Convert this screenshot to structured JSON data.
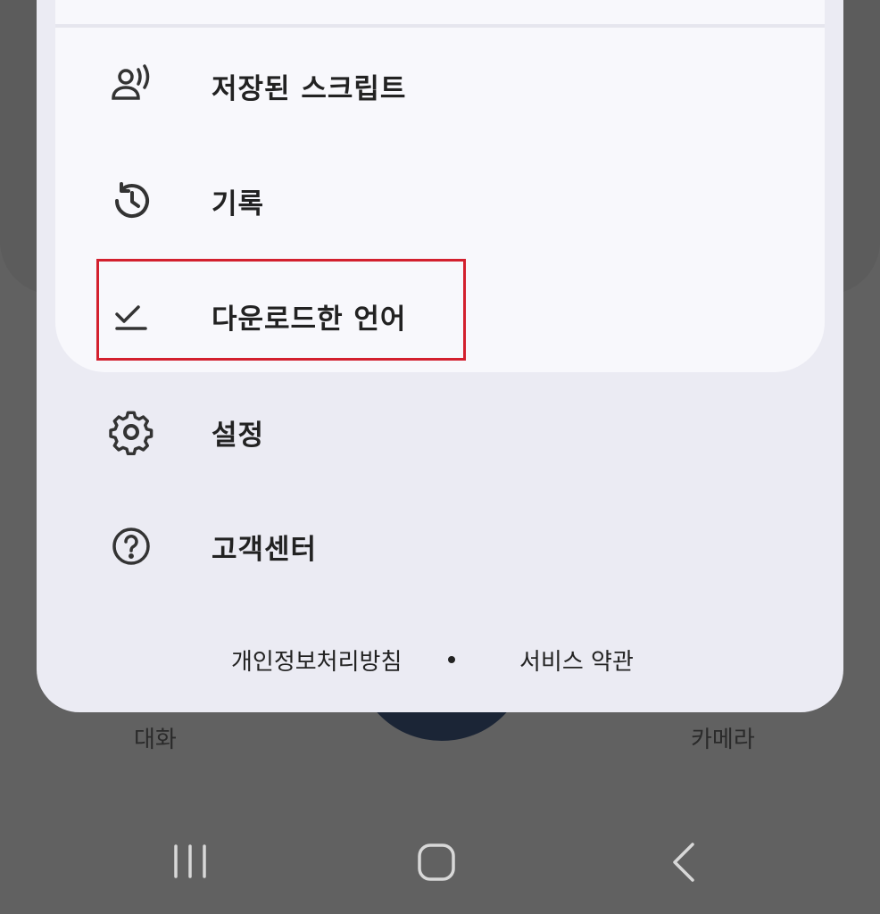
{
  "background": {
    "label_left": "대화",
    "label_right": "카메라"
  },
  "menu": {
    "items": [
      {
        "label": "저장된 스크립트",
        "icon": "saved-scripts-icon"
      },
      {
        "label": "기록",
        "icon": "history-icon"
      },
      {
        "label": "다운로드한 언어",
        "icon": "checkmark-icon"
      },
      {
        "label": "설정",
        "icon": "gear-icon"
      },
      {
        "label": "고객센터",
        "icon": "help-icon"
      }
    ]
  },
  "footer": {
    "privacy_label": "개인정보처리방침",
    "terms_label": "서비스 약관"
  },
  "colors": {
    "highlight": "#d3202e",
    "sheet": "#ebebf3",
    "card": "#f8f8fc",
    "scrim": "#616161"
  }
}
